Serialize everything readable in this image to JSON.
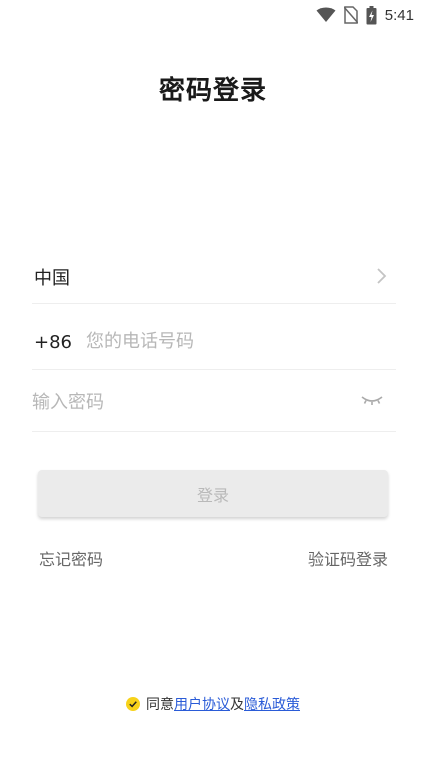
{
  "status_bar": {
    "time": "5:41",
    "icons": [
      "wifi-icon",
      "no-sim-icon",
      "battery-charging-icon"
    ]
  },
  "page": {
    "title": "密码登录"
  },
  "form": {
    "country": {
      "label": "中国",
      "icon": "chevron-right-icon"
    },
    "phone": {
      "country_code": "+86",
      "placeholder": "您的电话号码",
      "value": ""
    },
    "password": {
      "placeholder": "输入密码",
      "value": "",
      "icon": "eye-closed-icon"
    }
  },
  "actions": {
    "login_label": "登录",
    "forgot_password": "忘记密码",
    "sms_login": "验证码登录"
  },
  "agreement": {
    "prefix": "同意",
    "user_agreement": "用户协议",
    "and": "及",
    "privacy_policy": "隐私政策",
    "checked": true
  },
  "colors": {
    "check_yellow": "#f7d21a",
    "link_blue": "#2a5bd7",
    "button_disabled_bg": "#ebebeb",
    "button_disabled_text": "#b9b9b9"
  }
}
